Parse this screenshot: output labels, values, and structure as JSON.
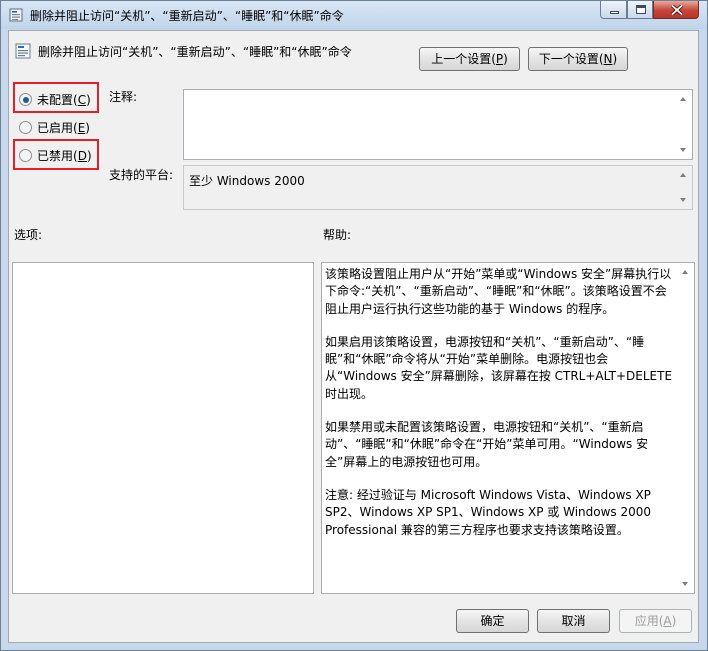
{
  "window": {
    "title": "删除并阻止访问“关机”、“重新启动”、“睡眠”和“休眠”命令"
  },
  "policy": {
    "name": "删除并阻止访问“关机”、“重新启动”、“睡眠”和“休眠”命令"
  },
  "nav": {
    "prev_label": "上一个设置(",
    "prev_key": "P",
    "next_label": "下一个设置(",
    "next_key": "N",
    "close_paren": ")"
  },
  "options": [
    {
      "label": "未配置(",
      "key": "C",
      "selected": true
    },
    {
      "label": "已启用(",
      "key": "E",
      "selected": false
    },
    {
      "label": "已禁用(",
      "key": "D",
      "selected": false
    }
  ],
  "comment": {
    "label": "注释:",
    "value": ""
  },
  "platform": {
    "label": "支持的平台:",
    "value": "至少 Windows 2000"
  },
  "sections": {
    "options_label": "选项:",
    "help_label": "帮助:"
  },
  "help": {
    "paragraphs": [
      "该策略设置阻止用户从“开始”菜单或“Windows 安全”屏幕执行以下命令:“关机”、“重新启动”、“睡眠”和“休眠”。该策略设置不会阻止用户运行执行这些功能的基于 Windows 的程序。",
      "如果启用该策略设置，电源按钮和“关机”、“重新启动”、“睡眠”和“休眠”命令将从“开始”菜单删除。电源按钮也会从“Windows 安全”屏幕删除，该屏幕在按 CTRL+ALT+DELETE 时出现。",
      "如果禁用或未配置该策略设置，电源按钮和“关机”、“重新启动”、“睡眠”和“休眠”命令在“开始”菜单可用。“Windows 安全”屏幕上的电源按钮也可用。",
      "注意: 经过验证与 Microsoft Windows Vista、Windows XP SP2、Windows XP SP1、Windows XP 或 Windows 2000 Professional 兼容的第三方程序也要求支持该策略设置。"
    ]
  },
  "footer": {
    "ok_label": "确定",
    "cancel_label": "取消",
    "apply_label": "应用(",
    "apply_key": "A",
    "close_paren": ")"
  },
  "colors": {
    "highlight": "#e2202a",
    "radio_selected": "#1d5c9a"
  }
}
